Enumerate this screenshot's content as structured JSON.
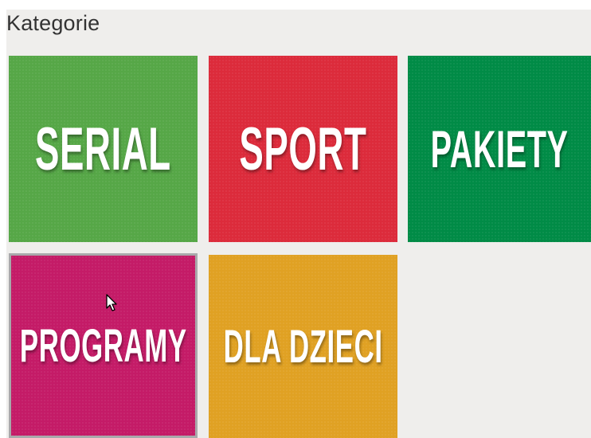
{
  "header": {
    "title": "Kategorie"
  },
  "tiles": [
    {
      "label": "SERIAL",
      "color": "#56a747"
    },
    {
      "label": "SPORT",
      "color": "#dc2b3b"
    },
    {
      "label": "PAKIETY",
      "color": "#008b46"
    },
    {
      "label": "PROGRAMY",
      "color": "#c41b67"
    },
    {
      "label": "DLA DZIECI",
      "color": "#e0a123"
    }
  ],
  "colors": {
    "background": "#efeeec",
    "selected_border": "#a9a9ab",
    "text": "#ffffff"
  },
  "icons": {
    "cursor": "mouse-pointer-icon"
  }
}
